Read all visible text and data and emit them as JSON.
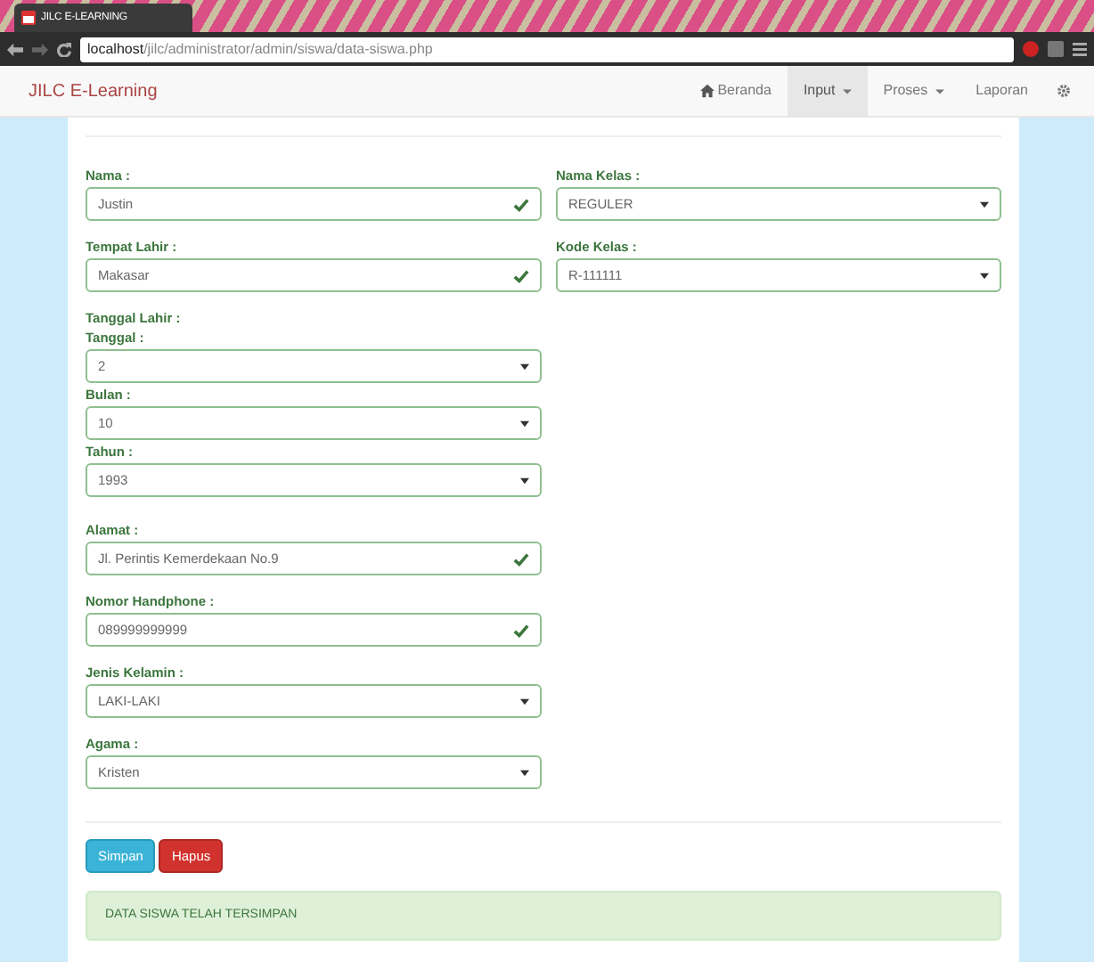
{
  "browser": {
    "tab_title": "JILC E-LEARNING",
    "address_host": "localhost",
    "address_path": "/jilc/administrator/admin/siswa/data-siswa.php"
  },
  "navbar": {
    "brand": "JILC E-Learning",
    "items": [
      {
        "label": "Beranda",
        "kind": "home",
        "selected": false
      },
      {
        "label": "Input",
        "kind": "dropdown",
        "selected": true
      },
      {
        "label": "Proses",
        "kind": "dropdown",
        "selected": false
      },
      {
        "label": "Laporan",
        "kind": "link",
        "selected": false
      },
      {
        "kind": "settings",
        "selected": false
      }
    ]
  },
  "left_fields": [
    {
      "kind": "input",
      "label": "Nama :",
      "value": "Justin",
      "valid": true
    },
    {
      "kind": "input",
      "label": "Tempat Lahir :",
      "value": "Makasar",
      "valid": true
    },
    {
      "kind": "group",
      "label": "Tanggal Lahir :",
      "children": [
        {
          "kind": "select",
          "label": "Tanggal :",
          "value": "2",
          "valid": true
        },
        {
          "kind": "select",
          "label": "Bulan :",
          "value": "10",
          "valid": true
        },
        {
          "kind": "select",
          "label": "Tahun :",
          "value": "1993",
          "valid": true
        }
      ]
    },
    {
      "kind": "input",
      "label": "Alamat :",
      "value": "Jl. Perintis Kemerdekaan No.9",
      "valid": true
    },
    {
      "kind": "input",
      "label": "Nomor Handphone :",
      "value": "089999999999",
      "valid": true
    },
    {
      "kind": "select",
      "label": "Jenis Kelamin :",
      "value": "LAKI-LAKI",
      "valid": true
    },
    {
      "kind": "select",
      "label": "Agama :",
      "value": "Kristen",
      "valid": true
    }
  ],
  "right_fields": [
    {
      "kind": "select",
      "label": "Nama Kelas :",
      "value": "REGULER",
      "valid": true
    },
    {
      "kind": "select",
      "label": "Kode Kelas :",
      "value": "R-111111",
      "valid": true
    }
  ],
  "buttons": [
    {
      "label": "Simpan",
      "kind": "primary"
    },
    {
      "label": "Hapus",
      "kind": "danger"
    }
  ],
  "alert": {
    "kind": "success",
    "text": "DATA SISWA TELAH TERSIMPAN"
  }
}
